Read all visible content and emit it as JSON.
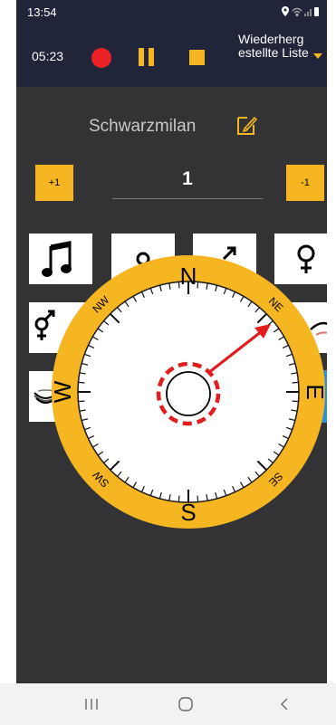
{
  "status_bar": {
    "time": "13:54",
    "icons": [
      "location-icon",
      "wifi-icon",
      "signal-icon",
      "battery-icon"
    ]
  },
  "toolbar": {
    "recording_time": "05:23",
    "list_label": "Wiederherg estellte Liste"
  },
  "species": {
    "name": "Schwarzmilan"
  },
  "counter": {
    "plus_label": "+1",
    "minus_label": "-1",
    "value": "1"
  },
  "symbol_tiles": [
    "song-note-icon",
    "unknown-sex-icon",
    "male-icon",
    "female-icon",
    "pair-icon",
    "nest-icon"
  ],
  "compass": {
    "labels": {
      "n": "N",
      "s": "S",
      "e": "E",
      "w": "W",
      "ne": "NE",
      "nw": "NW",
      "se": "SE",
      "sw": "SW"
    },
    "selected_direction": "NE"
  },
  "colors": {
    "accent": "#f5b622",
    "toolbar_bg": "#20253a",
    "app_bg": "#333336",
    "record": "#ec2228",
    "highlight": "#e31d1d"
  }
}
